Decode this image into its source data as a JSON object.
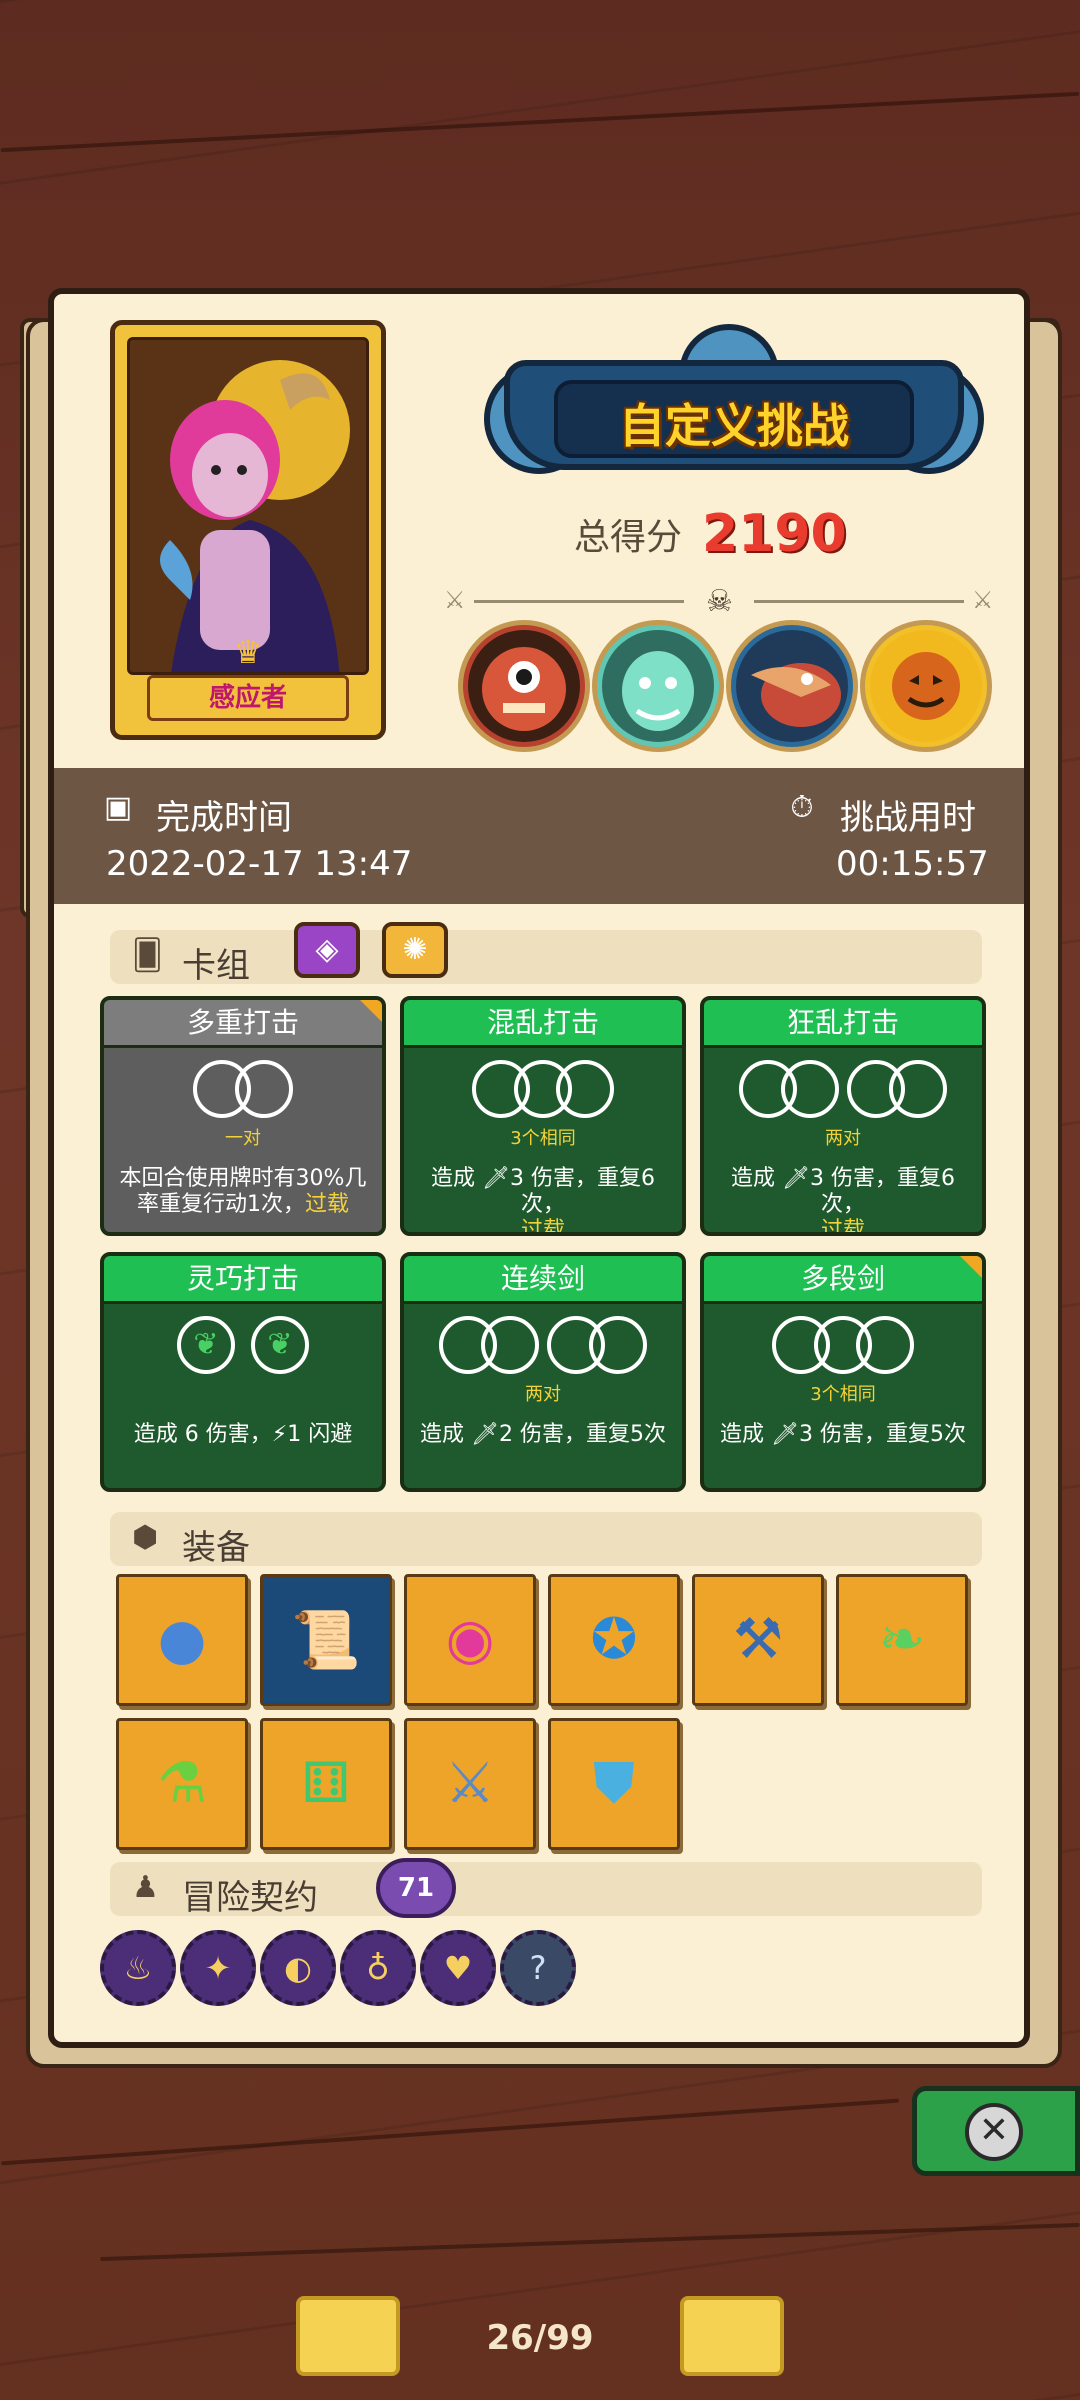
{
  "hero": {
    "name": "感应者"
  },
  "title": "自定义挑战",
  "score": {
    "label": "总得分",
    "value": "2190"
  },
  "time": {
    "completion_label": "完成时间",
    "completion_value": "2022-02-17 13:47",
    "duration_label": "挑战用时",
    "duration_value": "00:15:57"
  },
  "deck": {
    "label": "卡组",
    "cards": [
      {
        "name": "多重打击",
        "rings": "一对",
        "desc": "本回合使用牌时有30%几率重复行动1次，",
        "highlight": "过载",
        "style": "gray"
      },
      {
        "name": "混乱打击",
        "rings": "3个相同",
        "desc": "造成 🗡3 伤害，重复6次，",
        "highlight": "过载",
        "style": "green"
      },
      {
        "name": "狂乱打击",
        "rings": "两对",
        "desc": "造成 🗡3 伤害，重复6次，",
        "highlight": "过载",
        "style": "green"
      },
      {
        "name": "灵巧打击",
        "rings": "",
        "desc": "造成 6 伤害，⚡1 闪避",
        "highlight": "",
        "style": "green"
      },
      {
        "name": "连续剑",
        "rings": "两对",
        "desc": "造成 🗡2 伤害，重复5次",
        "highlight": "",
        "style": "green"
      },
      {
        "name": "多段剑",
        "rings": "3个相同",
        "desc": "造成 🗡3 伤害，重复5次",
        "highlight": "",
        "style": "green"
      }
    ]
  },
  "equipment": {
    "label": "装备"
  },
  "contract": {
    "label": "冒险契约",
    "badge": "71"
  },
  "pagination": {
    "current": "26/99"
  },
  "colors": {
    "accent_green": "#1fbf54",
    "score_red": "#ea3b2f",
    "gold": "#f5d252"
  }
}
